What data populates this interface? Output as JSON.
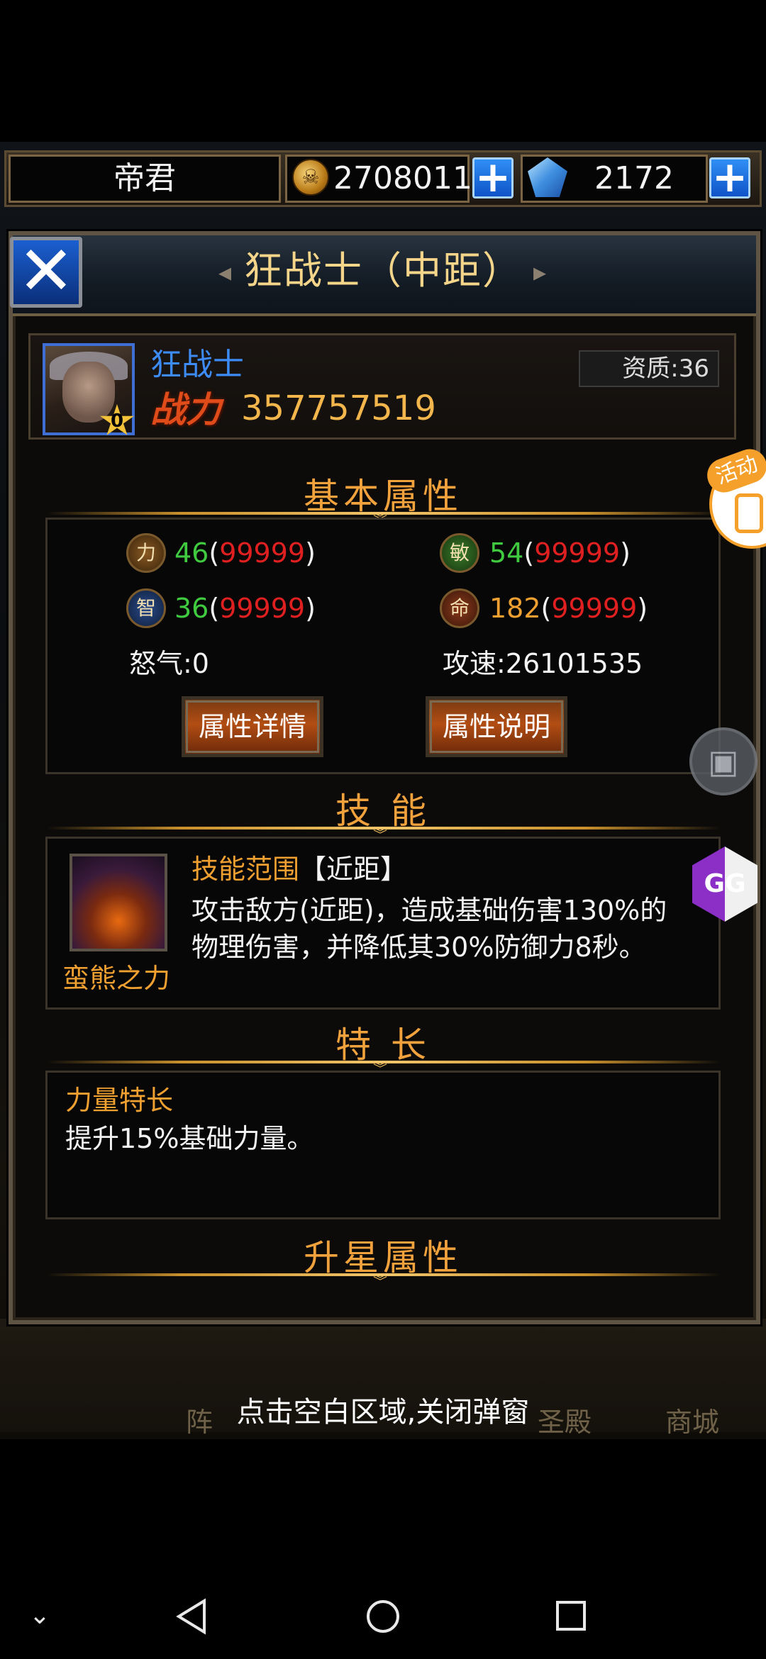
{
  "top_bar": {
    "player_name": "帝君",
    "gold_amount": "2708011",
    "diamond_amount": "2172",
    "plus_symbol": "+"
  },
  "dialog": {
    "title": "狂战士（中距）",
    "close_symbol": "✕",
    "hero": {
      "name": "狂战士",
      "power_label": "战力",
      "power_value": "357757519",
      "aptitude": "资质:36",
      "star_level": "0"
    },
    "basic_attributes": {
      "heading": "基本属性",
      "stats": [
        {
          "icon_char": "力",
          "value": "46",
          "max": "99999"
        },
        {
          "icon_char": "敏",
          "value": "54",
          "max": "99999"
        },
        {
          "icon_char": "智",
          "value": "36",
          "max": "99999"
        },
        {
          "icon_char": "命",
          "value": "182",
          "max": "99999"
        }
      ],
      "rage": "怒气:0",
      "attack_speed": "攻速:26101535",
      "detail_button": "属性详情",
      "explain_button": "属性说明"
    },
    "skill": {
      "heading": "技 能",
      "range_label": "技能范围",
      "range_value": "【近距】",
      "description_line1": "攻击敌方(近距)，造成基础伤害130%的",
      "description_line2": "物理伤害，并降低其30%防御力8秒。",
      "skill_name": "蛮熊之力"
    },
    "specialty": {
      "heading": "特 长",
      "name": "力量特长",
      "description": "提升15%基础力量。"
    },
    "star_attributes": {
      "heading": "升星属性"
    }
  },
  "overlays": {
    "activity_tag": "活动",
    "gg_label": "GG"
  },
  "background_nav": {
    "labels": [
      "阵",
      "圣殿",
      "商城"
    ]
  },
  "close_hint": "点击空白区域,关闭弹窗",
  "colors": {
    "section_heading": "#f2a23c",
    "stat_value_green": "#3fca3f",
    "stat_max_red": "#e02020",
    "stat_value_orange": "#f0a030",
    "hero_name_blue": "#3d8cf5",
    "power_gold": "#f2b64c"
  },
  "icons": {
    "system_nav": [
      "chevron-down-icon",
      "back-icon",
      "home-icon",
      "recents-icon"
    ]
  }
}
